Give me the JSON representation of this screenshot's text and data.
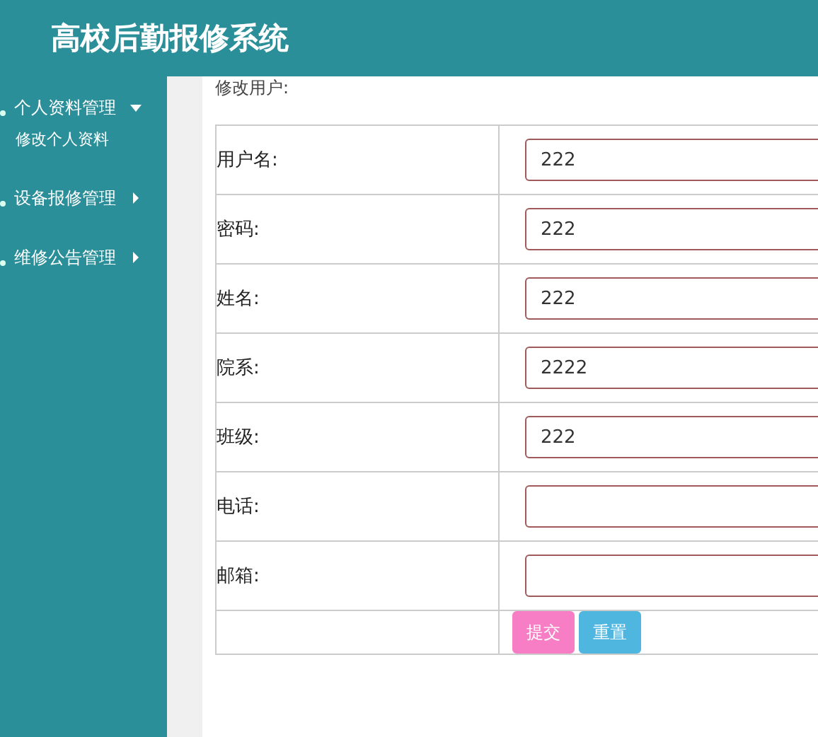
{
  "header": {
    "title": "高校后勤报修系统"
  },
  "sidebar": {
    "items": [
      {
        "label": "个人资料管理",
        "expanded": true,
        "children": [
          {
            "label": "修改个人资料"
          }
        ]
      },
      {
        "label": "设备报修管理",
        "expanded": false
      },
      {
        "label": "维修公告管理",
        "expanded": false
      }
    ]
  },
  "form": {
    "caption": "修改用户:",
    "fields": [
      {
        "label": "用户名:",
        "value": "222"
      },
      {
        "label": "密码:",
        "value": "222"
      },
      {
        "label": "姓名:",
        "value": "222"
      },
      {
        "label": "院系:",
        "value": "2222"
      },
      {
        "label": "班级:",
        "value": "222"
      },
      {
        "label": "电话:"
      },
      {
        "label": "邮箱:"
      }
    ],
    "buttons": [
      {
        "label": "提交",
        "kind": "submit"
      },
      {
        "label": "重置",
        "kind": "reset"
      }
    ]
  }
}
